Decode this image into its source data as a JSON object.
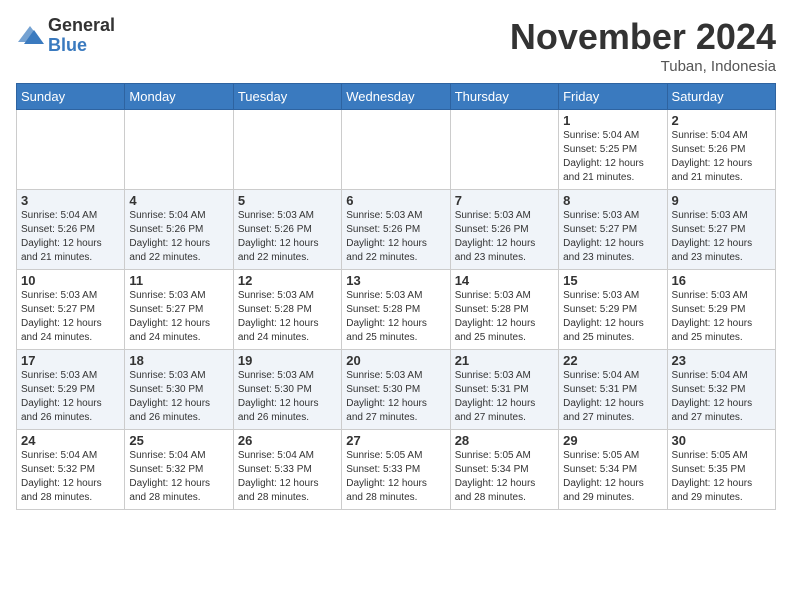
{
  "header": {
    "logo_line1": "General",
    "logo_line2": "Blue",
    "month_title": "November 2024",
    "location": "Tuban, Indonesia"
  },
  "weekdays": [
    "Sunday",
    "Monday",
    "Tuesday",
    "Wednesday",
    "Thursday",
    "Friday",
    "Saturday"
  ],
  "weeks": [
    [
      {
        "day": "",
        "info": ""
      },
      {
        "day": "",
        "info": ""
      },
      {
        "day": "",
        "info": ""
      },
      {
        "day": "",
        "info": ""
      },
      {
        "day": "",
        "info": ""
      },
      {
        "day": "1",
        "info": "Sunrise: 5:04 AM\nSunset: 5:25 PM\nDaylight: 12 hours\nand 21 minutes."
      },
      {
        "day": "2",
        "info": "Sunrise: 5:04 AM\nSunset: 5:26 PM\nDaylight: 12 hours\nand 21 minutes."
      }
    ],
    [
      {
        "day": "3",
        "info": "Sunrise: 5:04 AM\nSunset: 5:26 PM\nDaylight: 12 hours\nand 21 minutes."
      },
      {
        "day": "4",
        "info": "Sunrise: 5:04 AM\nSunset: 5:26 PM\nDaylight: 12 hours\nand 22 minutes."
      },
      {
        "day": "5",
        "info": "Sunrise: 5:03 AM\nSunset: 5:26 PM\nDaylight: 12 hours\nand 22 minutes."
      },
      {
        "day": "6",
        "info": "Sunrise: 5:03 AM\nSunset: 5:26 PM\nDaylight: 12 hours\nand 22 minutes."
      },
      {
        "day": "7",
        "info": "Sunrise: 5:03 AM\nSunset: 5:26 PM\nDaylight: 12 hours\nand 23 minutes."
      },
      {
        "day": "8",
        "info": "Sunrise: 5:03 AM\nSunset: 5:27 PM\nDaylight: 12 hours\nand 23 minutes."
      },
      {
        "day": "9",
        "info": "Sunrise: 5:03 AM\nSunset: 5:27 PM\nDaylight: 12 hours\nand 23 minutes."
      }
    ],
    [
      {
        "day": "10",
        "info": "Sunrise: 5:03 AM\nSunset: 5:27 PM\nDaylight: 12 hours\nand 24 minutes."
      },
      {
        "day": "11",
        "info": "Sunrise: 5:03 AM\nSunset: 5:27 PM\nDaylight: 12 hours\nand 24 minutes."
      },
      {
        "day": "12",
        "info": "Sunrise: 5:03 AM\nSunset: 5:28 PM\nDaylight: 12 hours\nand 24 minutes."
      },
      {
        "day": "13",
        "info": "Sunrise: 5:03 AM\nSunset: 5:28 PM\nDaylight: 12 hours\nand 25 minutes."
      },
      {
        "day": "14",
        "info": "Sunrise: 5:03 AM\nSunset: 5:28 PM\nDaylight: 12 hours\nand 25 minutes."
      },
      {
        "day": "15",
        "info": "Sunrise: 5:03 AM\nSunset: 5:29 PM\nDaylight: 12 hours\nand 25 minutes."
      },
      {
        "day": "16",
        "info": "Sunrise: 5:03 AM\nSunset: 5:29 PM\nDaylight: 12 hours\nand 25 minutes."
      }
    ],
    [
      {
        "day": "17",
        "info": "Sunrise: 5:03 AM\nSunset: 5:29 PM\nDaylight: 12 hours\nand 26 minutes."
      },
      {
        "day": "18",
        "info": "Sunrise: 5:03 AM\nSunset: 5:30 PM\nDaylight: 12 hours\nand 26 minutes."
      },
      {
        "day": "19",
        "info": "Sunrise: 5:03 AM\nSunset: 5:30 PM\nDaylight: 12 hours\nand 26 minutes."
      },
      {
        "day": "20",
        "info": "Sunrise: 5:03 AM\nSunset: 5:30 PM\nDaylight: 12 hours\nand 27 minutes."
      },
      {
        "day": "21",
        "info": "Sunrise: 5:03 AM\nSunset: 5:31 PM\nDaylight: 12 hours\nand 27 minutes."
      },
      {
        "day": "22",
        "info": "Sunrise: 5:04 AM\nSunset: 5:31 PM\nDaylight: 12 hours\nand 27 minutes."
      },
      {
        "day": "23",
        "info": "Sunrise: 5:04 AM\nSunset: 5:32 PM\nDaylight: 12 hours\nand 27 minutes."
      }
    ],
    [
      {
        "day": "24",
        "info": "Sunrise: 5:04 AM\nSunset: 5:32 PM\nDaylight: 12 hours\nand 28 minutes."
      },
      {
        "day": "25",
        "info": "Sunrise: 5:04 AM\nSunset: 5:32 PM\nDaylight: 12 hours\nand 28 minutes."
      },
      {
        "day": "26",
        "info": "Sunrise: 5:04 AM\nSunset: 5:33 PM\nDaylight: 12 hours\nand 28 minutes."
      },
      {
        "day": "27",
        "info": "Sunrise: 5:05 AM\nSunset: 5:33 PM\nDaylight: 12 hours\nand 28 minutes."
      },
      {
        "day": "28",
        "info": "Sunrise: 5:05 AM\nSunset: 5:34 PM\nDaylight: 12 hours\nand 28 minutes."
      },
      {
        "day": "29",
        "info": "Sunrise: 5:05 AM\nSunset: 5:34 PM\nDaylight: 12 hours\nand 29 minutes."
      },
      {
        "day": "30",
        "info": "Sunrise: 5:05 AM\nSunset: 5:35 PM\nDaylight: 12 hours\nand 29 minutes."
      }
    ]
  ]
}
